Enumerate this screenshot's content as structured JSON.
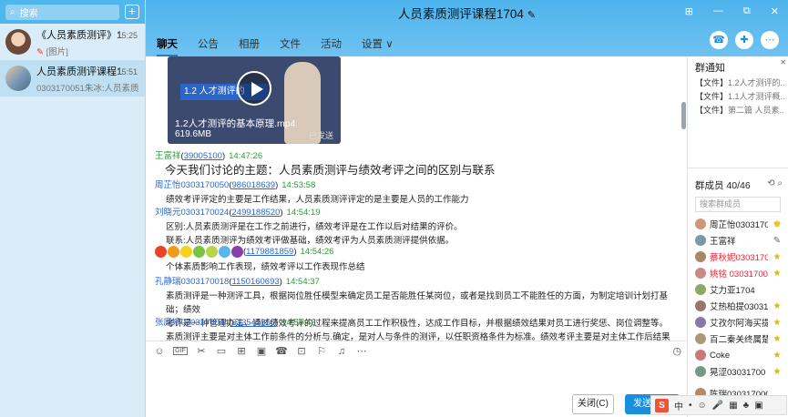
{
  "sidebar": {
    "search_placeholder": "搜索",
    "plus": "+",
    "conversations": [
      {
        "name": "《人员素质测评》1",
        "preview_tag": "[图片]",
        "time": "15:25"
      },
      {
        "name": "人员素质测评课程1",
        "preview": "0303170051朱冰:人员素质测",
        "time": "15:51"
      }
    ]
  },
  "header": {
    "title": "人员素质测评课程1704",
    "edit_icon": "✎",
    "tabs": [
      "聊天",
      "公告",
      "相册",
      "文件",
      "活动",
      "设置 ∨"
    ],
    "win_controls": [
      "⊞",
      "—",
      "⧉",
      "✕"
    ],
    "actions": [
      "☎",
      "✚",
      "⋯"
    ]
  },
  "video": {
    "band": "1.2 人才测评的",
    "name": "1.2人才测评的基本原理.mp4",
    "size": "619.6MB",
    "status": "已发送"
  },
  "messages": [
    {
      "name": "王富祥",
      "qq": "39005100",
      "time": "14:47:26",
      "text": "今天我们讨论的主题：人员素质测评与绩效考评之间的区别与联系"
    },
    {
      "name": "周芷怡0303170050",
      "qq": "986018639",
      "time": "14:53:58",
      "text": "绩效考评评定的主要是工作结果，人员素质测评评定的是主要是人员的工作能力"
    },
    {
      "name": "刘晓元0303170024",
      "qq": "2499188520",
      "time": "14:54:19",
      "text": "区别:人员素质测评是在工作之前进行，绩效考评是在工作以后对结果的评价。",
      "text2": "联系:人员素质测评为绩效考评做基础，绩效考评为人员素质测评提供依据。"
    },
    {
      "qq": "1179881859",
      "time": "14:54:26",
      "text": "个体素质影响工作表现，绩效考评以工作表现作总结"
    },
    {
      "name": "孔静瑞0303170018",
      "qq": "1150160693",
      "time": "14:54:37",
      "text": "素质测评是一种测评工具，根据岗位胜任模型来确定员工是否能胜任某岗位，或者是找到员工不能胜任的方面，为制定培训计划打基础；绩效",
      "text2": "考评是一种管理办法，通过绩效考评的过程来提高员工工作积极性，达成工作目标，并根据绩效结果对员工进行奖惩、岗位调整等。"
    },
    {
      "name": "张庭婷0303170044",
      "qq": "613542850",
      "time": "14:55:42",
      "text": "素质测评主要是对主体工作前条件的分析与.确定，是对人与条件的测评，以任职资格条件为标准。绩效考评主要是对主体工作后结果的分析与"
    }
  ],
  "toolbar": {
    "icons": [
      "☺",
      "GIF",
      "✂",
      "▭",
      "⊞",
      "▣",
      "☎",
      "⊡",
      "⚐",
      "♫",
      "⋯"
    ],
    "history": "◷"
  },
  "buttons": {
    "close": "关闭(C)",
    "send": "发送(S)"
  },
  "right": {
    "notice_title": "群通知",
    "notices": [
      {
        "tag": "【文件】",
        "text": "1.2人才测评的..."
      },
      {
        "tag": "【文件】",
        "text": "1.1人才测评概..."
      },
      {
        "tag": "【文件】",
        "text": "第二篇 人员素..."
      }
    ],
    "members_title": "群成员 40/46",
    "member_tools": "⟲  ⌕",
    "member_search_placeholder": "搜索群成员",
    "members": [
      {
        "name": "周芷怡0303170",
        "role": "♚",
        "color": "#c97"
      },
      {
        "name": "王富祥",
        "role": "✎",
        "color": "#79a"
      },
      {
        "name": "蔡秋妮0303170",
        "role": "★",
        "color": "#a86",
        "red": true
      },
      {
        "name": "姚铭 03031700",
        "role": "★",
        "color": "#c88",
        "red": true
      },
      {
        "name": "艾力亚1704",
        "role": "",
        "color": "#8a6"
      },
      {
        "name": "艾热柏提03031",
        "role": "★",
        "color": "#976"
      },
      {
        "name": "艾孜尔阿海买提",
        "role": "★",
        "color": "#87a"
      },
      {
        "name": "百二秦关终属楚",
        "role": "★",
        "color": "#a97"
      },
      {
        "name": "Coke",
        "role": "★",
        "color": "#c77"
      },
      {
        "name": "晃涩03031700",
        "role": "★",
        "color": "#798"
      },
      {
        "name": "陈瑞0303170007",
        "role": "",
        "color": "#b86"
      }
    ]
  },
  "ime": {
    "logo": "S",
    "items": [
      "中",
      "•",
      "☺",
      "🎤",
      "▦",
      "♣",
      "▣",
      "▦"
    ]
  }
}
